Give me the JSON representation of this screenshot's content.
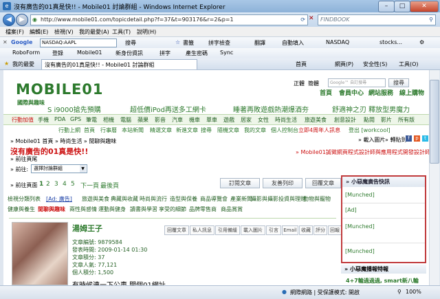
{
  "window": {
    "title": "沒有廣告的01真是快!! - Mobile01 討論群組 - Windows Internet Explorer"
  },
  "address": {
    "url": "http://www.mobile01.com/topicdetail.php?f=37&t=903176&r=2&p=1",
    "search_placeholder": "FINDBOOK"
  },
  "menu": [
    "檔案(F)",
    "編輯(E)",
    "檢視(V)",
    "我的最愛(A)",
    "工具(T)",
    "說明(H)"
  ],
  "google_toolbar": {
    "brand": "Google",
    "query": "NASDAQ:AAPL",
    "search": "搜尋",
    "bookmark": "書籤",
    "spell": "拼字檢查",
    "translate": "翻譯",
    "autofill": "自動填入",
    "nasdaq": "NASDAQ",
    "stocks": "stocks...",
    "settings": "設定"
  },
  "links_toolbar": [
    "RoboForm",
    "登錄",
    "Mobile01",
    "新身份資訊",
    "拼字",
    "產生密碼",
    "Sync"
  ],
  "tabs": {
    "favorites": "我的最愛",
    "active": "沒有廣告的01真是快!! - Mobile01 討論群組",
    "home": "首頁",
    "page": "網頁(P)",
    "safety": "安全性(S)",
    "tools": "工具(O)"
  },
  "site": {
    "logo": "MOBILE01",
    "tagline": "國際與趣味",
    "top_links": [
      "正體",
      "簡體"
    ],
    "search_label": "搜尋",
    "search_placeholder": "Google™ 自訂搜尋",
    "main_links": [
      "首頁",
      "會員中心",
      "網站服務",
      "線上購物"
    ],
    "banners": [
      "S i9000搶先預購",
      "超低價iPod再送多工網卡",
      "睡著再敗遊戲熱潮爆酒夯",
      "舒適神之刃 釋放型男魔力"
    ],
    "nav": [
      "行動加值",
      "手機",
      "PDA",
      "GPS",
      "筆電",
      "相機",
      "電腦",
      "蘋果",
      "影音",
      "汽車",
      "機車",
      "單車",
      "遊戲",
      "居家",
      "女性",
      "時尚生活",
      "旅遊美食",
      "創意設計",
      "點閱",
      "影片",
      "所有版"
    ],
    "subnav": [
      "行動上網",
      "首頁",
      "行事曆",
      "本站新聞",
      "精選文章",
      "新進文章",
      "搜尋",
      "隨機文章",
      "我的文章",
      "個人控制台",
      "立即4周年人訊息",
      "登出 [workcool]"
    ],
    "breadcrumb": "» Mobile01 首頁 » 時尚生活 » 閒聊與趣味",
    "topic_title": "沒有廣告的01真是快!!",
    "ad_link": "» Mobile01誠徵網頁程式設計師與應用程式開發設計師",
    "login_links": [
      "» 載入圖片",
      "» 轉貼到"
    ],
    "goto_label": "» 前往頁尾",
    "goto_select_label": "» 前往:",
    "goto_select_value": "選擇討論群組",
    "pages_label": "» 前往頁面",
    "pages": [
      "1",
      "2",
      "3",
      "4",
      "5",
      "下一頁",
      "最後頁"
    ],
    "action_buttons": [
      "訂閱文章",
      "友善列印",
      "回覆文章"
    ],
    "categories_row1": [
      "檢視分類列表",
      "[Ad: 廣告]",
      "旅遊與美食",
      "典藏與收藏",
      "時尚與流行",
      "造型與保養",
      "商品導覽會",
      "產業新聞",
      "攝影與攝影",
      "投資與理財",
      "動物與寵物"
    ],
    "categories_row2": [
      "健康與養生",
      "閒聊與趣味",
      "兩性與感情",
      "運動與健身",
      "讀書與學習",
      "享受的細節",
      "品牌零售商",
      "商品賞賞"
    ],
    "author": "湯姆王子",
    "post_tags": [
      "回覆文章",
      "私人訊息",
      "引用備緩",
      "載入圖片",
      "引言",
      "Email",
      "收藏",
      "評分",
      "回報"
    ],
    "stats": [
      "文章編號: 9879584",
      "發表時間: 2009-01-14 01:30",
      "文章積分: 37",
      "文章人氣: 77,121",
      "個人積分: 1,500"
    ],
    "post_preview": "有時候連一下公車 開個01網址",
    "sidebox_title": "» 小惡魔廣告快訊",
    "sidebox_items": [
      "[Munched]",
      "[Ad]",
      "[Munched]",
      "[Munched]"
    ],
    "sidebox2_title": "» 小惡魔播報特報",
    "sidebox2_item": "4+7輪過過過, smart新八輪"
  },
  "status": {
    "zone": "網際網路 | 受保護模式: 開啟",
    "zoom": "100%"
  }
}
